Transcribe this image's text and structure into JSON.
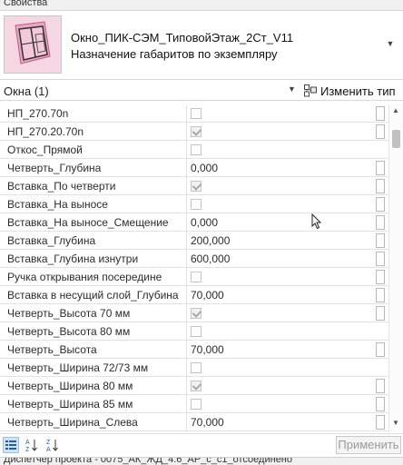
{
  "window": {
    "title": "Свойства"
  },
  "type_selector": {
    "family_name": "Окно_ПИК-СЭМ_ТиповойЭтаж_2Ст_V11",
    "type_name": "Назначение габаритов по экземпляру"
  },
  "filter": {
    "label": "Окна (1)",
    "edit_type_label": "Изменить тип"
  },
  "properties": [
    {
      "name": "НП_270.70n",
      "kind": "check",
      "checked": false,
      "button": true
    },
    {
      "name": "НП_270.20.70n",
      "kind": "check",
      "checked": true,
      "button": true
    },
    {
      "name": "Откос_Прямой",
      "kind": "check",
      "checked": false,
      "button": false
    },
    {
      "name": "Четверть_Глубина",
      "kind": "text",
      "value": "0,000",
      "button": true
    },
    {
      "name": "Вставка_По четверти",
      "kind": "check",
      "checked": true,
      "button": true
    },
    {
      "name": "Вставка_На выносе",
      "kind": "check",
      "checked": false,
      "button": true
    },
    {
      "name": "Вставка_На выносе_Смещение",
      "kind": "text",
      "value": "0,000",
      "button": true
    },
    {
      "name": "Вставка_Глубина",
      "kind": "text",
      "value": "200,000",
      "button": true
    },
    {
      "name": "Вставка_Глубина изнутри",
      "kind": "text",
      "value": "600,000",
      "button": true
    },
    {
      "name": "Ручка открывания посередине",
      "kind": "check",
      "checked": false,
      "button": true
    },
    {
      "name": "Вставка в несущий слой_Глубина",
      "kind": "text",
      "value": "70,000",
      "button": true
    },
    {
      "name": "Четверть_Высота 70 мм",
      "kind": "check",
      "checked": true,
      "button": true
    },
    {
      "name": "Четверть_Высота 80 мм",
      "kind": "check",
      "checked": false,
      "button": false
    },
    {
      "name": "Четверть_Высота",
      "kind": "text",
      "value": "70,000",
      "button": true
    },
    {
      "name": "Четверть_Ширина 72/73 мм",
      "kind": "check",
      "checked": false,
      "button": false
    },
    {
      "name": "Четверть_Ширина 80 мм",
      "kind": "check",
      "checked": true,
      "button": true
    },
    {
      "name": "Четверть_Ширина 85 мм",
      "kind": "check",
      "checked": false,
      "button": true
    },
    {
      "name": "Четверть_Ширина_Слева",
      "kind": "text",
      "value": "70,000",
      "button": true
    }
  ],
  "footer": {
    "apply_label": "Применить"
  },
  "status": {
    "text": "Диспетчер проекта - 0075_АК_ЖД_4.6_АР_с_с1_отсоединено"
  },
  "colors": {
    "thumb_bg": "#f7d6e4",
    "selected_tool": "#cfe3f5"
  }
}
